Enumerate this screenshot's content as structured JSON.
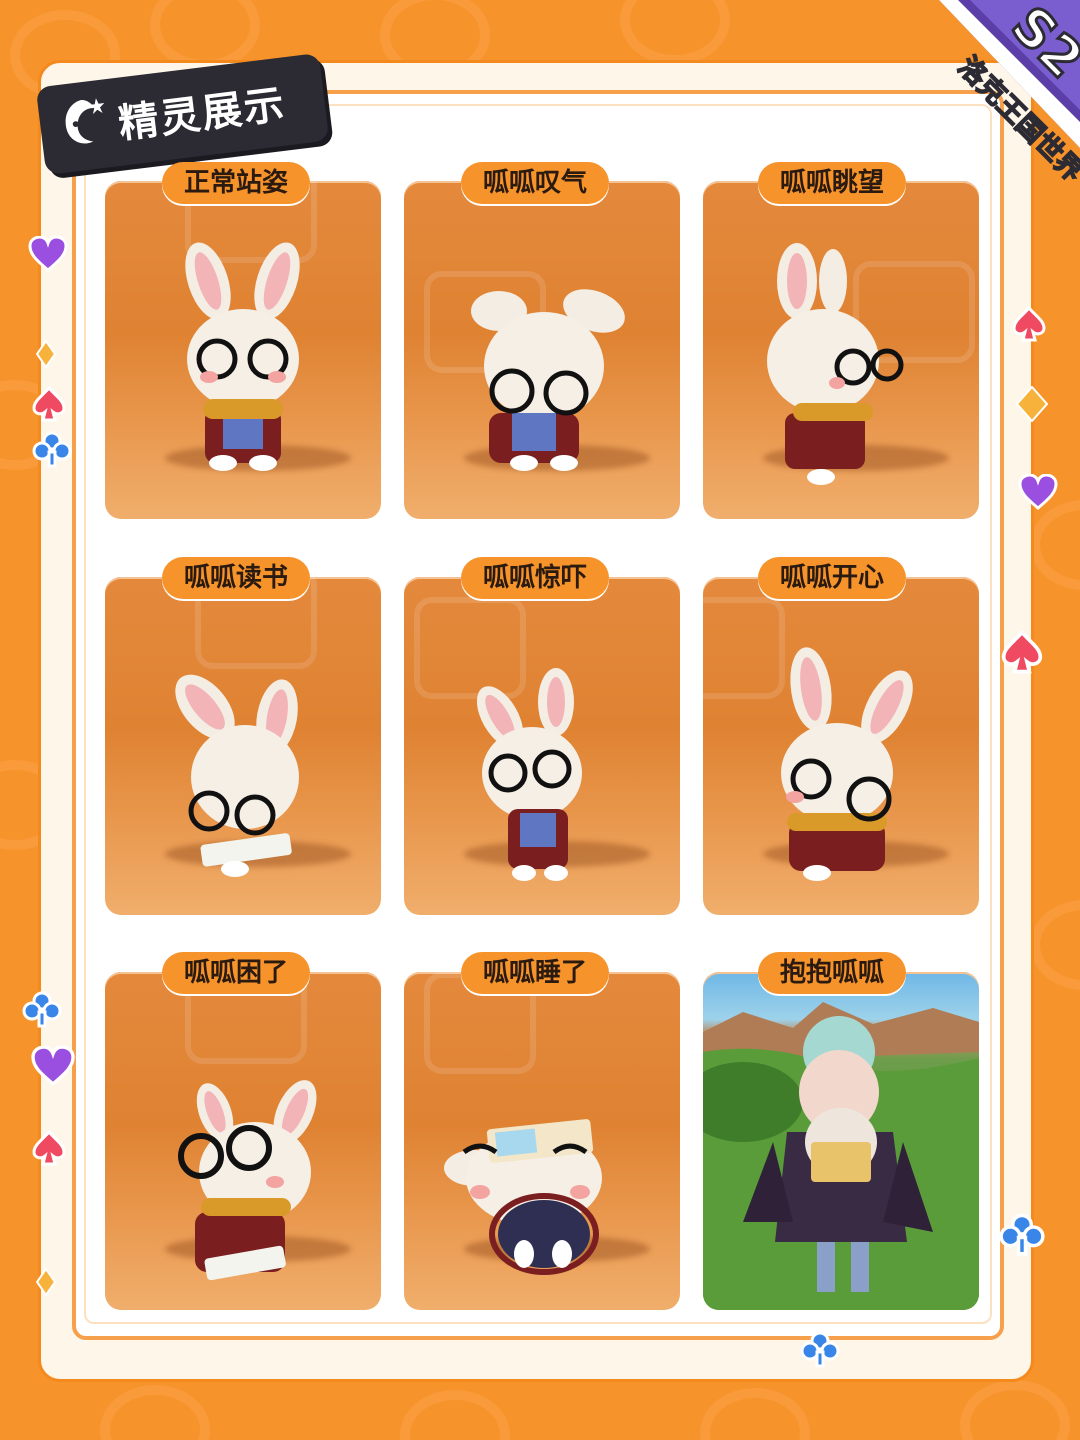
{
  "header": {
    "title": "精灵展示",
    "badge_top": "S2",
    "badge_bottom": "洛克王国世界"
  },
  "colors": {
    "background": "#f7932b",
    "card": "#e08634",
    "label_bg": "#f7932b",
    "title_tag": "#2c2a33",
    "badge": "#5b3ea8"
  },
  "cards": [
    {
      "label": "正常站姿"
    },
    {
      "label": "呱呱叹气"
    },
    {
      "label": "呱呱眺望"
    },
    {
      "label": "呱呱读书"
    },
    {
      "label": "呱呱惊吓"
    },
    {
      "label": "呱呱开心"
    },
    {
      "label": "呱呱困了"
    },
    {
      "label": "呱呱睡了"
    },
    {
      "label": "抱抱呱呱"
    }
  ],
  "decorations": [
    "heart-suit-icon",
    "spade-suit-icon",
    "club-suit-icon",
    "diamond-suit-icon"
  ]
}
